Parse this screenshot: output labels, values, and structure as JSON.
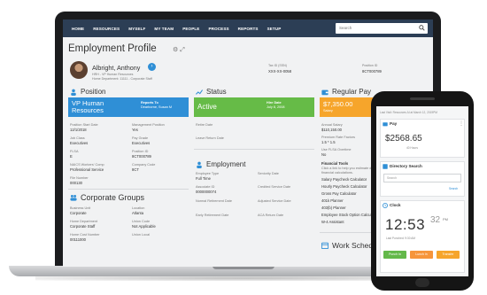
{
  "nav": {
    "items": [
      "HOME",
      "RESOURCES",
      "MYSELF",
      "MY TEAM",
      "PEOPLE",
      "PROCESS",
      "REPORTS",
      "SETUP"
    ],
    "search_placeholder": "Search"
  },
  "header": {
    "title": "Employment Profile",
    "employee_name": "Albright, Anthony",
    "subline1": "HRH - VP Human Resources",
    "subline2": "Home Department: 11111 - Corporate Staff",
    "tax_id_label": "Tax ID (SSN)",
    "tax_id_value": "XXX-XX-0058",
    "position_id_label": "Position ID",
    "position_id_value": "8CT000789"
  },
  "position": {
    "title": "Position",
    "banner_title": "VP Human Resources",
    "reports_to_label": "Reports To",
    "reports_to_value": "Dearborne, Susan M",
    "fields": [
      {
        "label": "Position Start Date",
        "value": "12/1/2018"
      },
      {
        "label": "Management Position",
        "value": "Yes"
      },
      {
        "label": "Job Class",
        "value": "Executives"
      },
      {
        "label": "Pay Grade",
        "value": "Executives"
      },
      {
        "label": "FLSA",
        "value": "E"
      },
      {
        "label": "Position ID",
        "value": "8CT000789"
      },
      {
        "label": "NAICS Workers' Comp",
        "value": "Professional Service"
      },
      {
        "label": "Company Code",
        "value": "8CT"
      },
      {
        "label": "File Number",
        "value": "000130"
      }
    ]
  },
  "status": {
    "title": "Status",
    "banner_value": "Active",
    "hire_label": "Hire Date",
    "hire_value": "July 8, 2008",
    "fields": [
      {
        "label": "Retire Date",
        "value": ""
      },
      {
        "label": "Leave Return Date",
        "value": ""
      }
    ]
  },
  "regular_pay": {
    "title": "Regular Pay",
    "banner_value": "$7,350.00",
    "banner_sub": "Salary",
    "fields": [
      {
        "label": "Annual Salary",
        "value": "$110,150.00"
      },
      {
        "label": "Premium Rate Factors",
        "value": "1.5 * 1.5"
      },
      {
        "label": "Use FLSA Overtime",
        "value": "No"
      }
    ],
    "tools_title": "Financial Tools",
    "tools_desc": "Click a link to help you estimate different financial calculations.",
    "tools": [
      "Salary Paycheck Calculator",
      "Hourly Paycheck Calculator",
      "Gross Pay Calculator",
      "401k Planner",
      "403(b) Planner",
      "Employee Stock Option Calculator",
      "W-4 Assistant"
    ]
  },
  "employment": {
    "title": "Employment",
    "fields": [
      {
        "label": "Employee Type",
        "value": "Full Time"
      },
      {
        "label": "Seniority Date",
        "value": ""
      },
      {
        "label": "Associate ID",
        "value": "0000000074"
      },
      {
        "label": "Credited Service Date",
        "value": ""
      },
      {
        "label": "Normal Retirement Date",
        "value": ""
      },
      {
        "label": "Adjusted Service Date",
        "value": ""
      },
      {
        "label": "Early Retirement Date",
        "value": ""
      },
      {
        "label": "ACA Return Date",
        "value": ""
      }
    ]
  },
  "corporate_groups": {
    "title": "Corporate Groups",
    "fields": [
      {
        "label": "Business Unit",
        "value": "Corporate"
      },
      {
        "label": "Location",
        "value": "Atlanta"
      },
      {
        "label": "Home Department",
        "value": "Corporate Staff"
      },
      {
        "label": "Union Code",
        "value": "Not Applicable"
      },
      {
        "label": "Home Cost Number",
        "value": "00111000"
      },
      {
        "label": "Union Local",
        "value": ""
      }
    ]
  },
  "work_schedule": {
    "title": "Work Schedul"
  },
  "phone": {
    "top_text": "Last Visit: Resources AI at March 12, 2019PM",
    "pay_title": "Pay",
    "pay_amount": "$2568.65",
    "pay_sub": "40 Hours",
    "directory_title": "Directory Search",
    "directory_placeholder": "Search",
    "directory_link": "Search",
    "clock_title": "Clock",
    "clock_time": "12:53",
    "clock_seconds": "32",
    "clock_ampm": "PM",
    "clock_status": "Last Punched: 9:30 AM",
    "buttons": [
      "Punch In",
      "Lunch In",
      "Transfer"
    ],
    "colors": {
      "green": "#63b84a",
      "orange": "#f6953b",
      "amber": "#f6a52b"
    }
  },
  "colors": {
    "nav": "#2c3e55",
    "position_banner": "#2f8fd6",
    "status_banner": "#66bb47",
    "pay_banner": "#f6a52b"
  }
}
